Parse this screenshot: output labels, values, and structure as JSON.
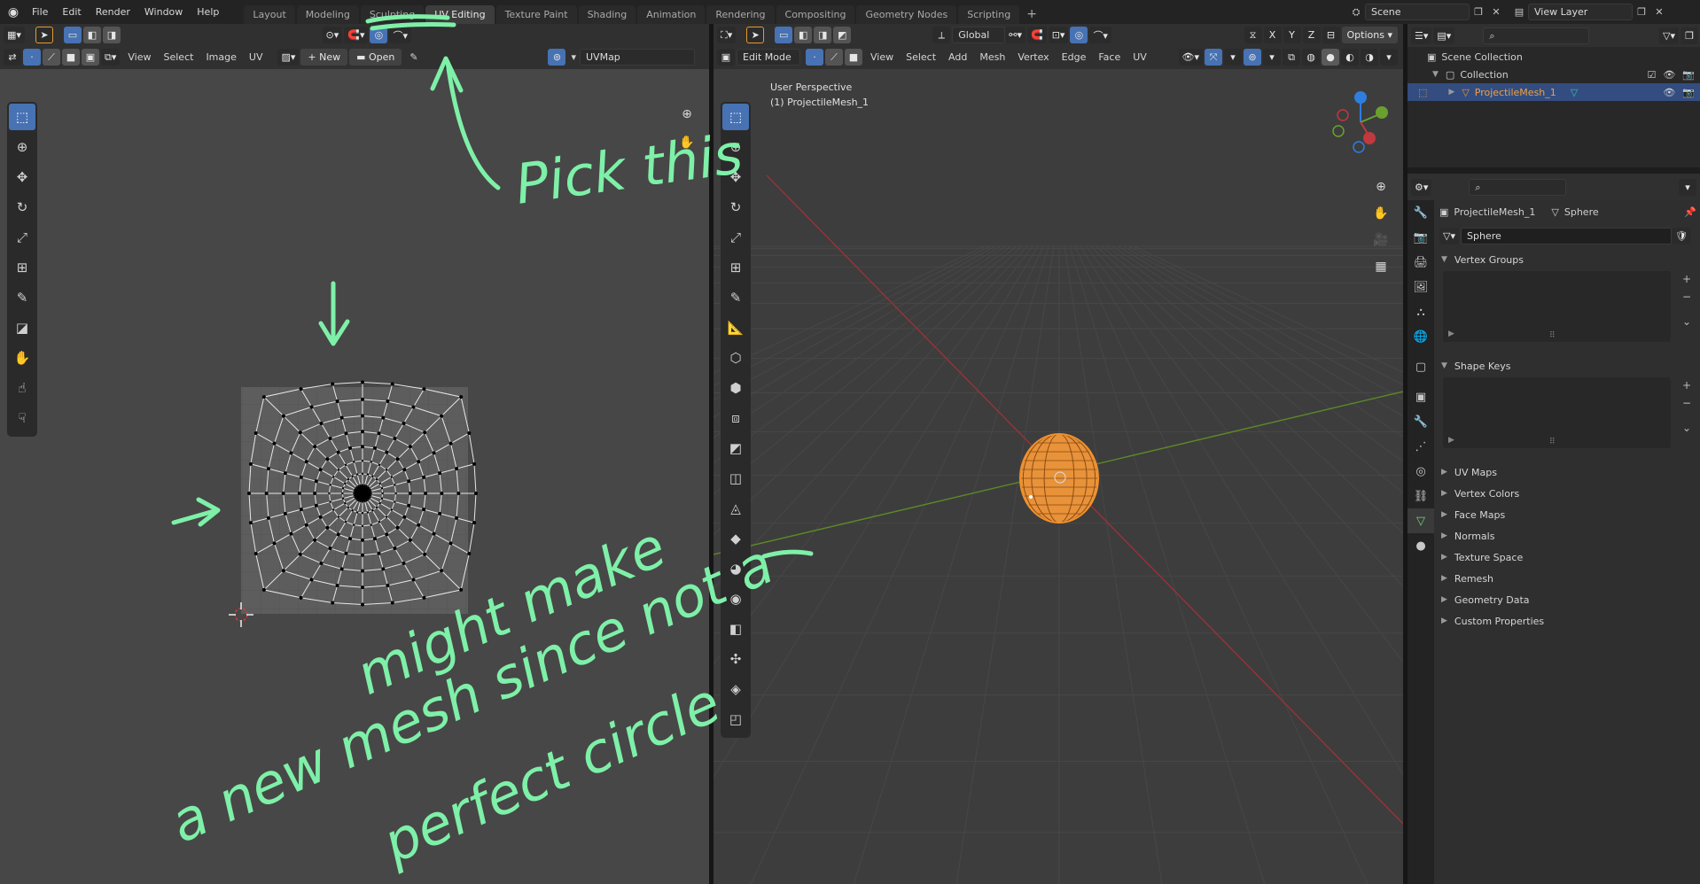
{
  "menubar": {
    "file": "File",
    "edit": "Edit",
    "render": "Render",
    "window": "Window",
    "help": "Help"
  },
  "workspaces": [
    "Layout",
    "Modeling",
    "Sculpting",
    "UV Editing",
    "Texture Paint",
    "Shading",
    "Animation",
    "Rendering",
    "Compositing",
    "Geometry Nodes",
    "Scripting"
  ],
  "active_workspace": "UV Editing",
  "scene": {
    "name": "Scene",
    "view_layer": "View Layer"
  },
  "uv_editor": {
    "menus": [
      "View",
      "Select",
      "Image",
      "UV"
    ],
    "new_label": "New",
    "open_label": "Open",
    "uvmap_name": "UVMap"
  },
  "viewport": {
    "mode": "Edit Mode",
    "menus": [
      "View",
      "Select",
      "Add",
      "Mesh",
      "Vertex",
      "Edge",
      "Face",
      "UV"
    ],
    "orientation": "Global",
    "options_label": "Options",
    "perspective_label": "User Perspective",
    "object_label": "(1) ProjectileMesh_1",
    "axis_x": "X",
    "axis_y": "Y",
    "axis_z": "Z"
  },
  "outliner": {
    "scene_collection": "Scene Collection",
    "collection": "Collection",
    "object": "ProjectileMesh_1"
  },
  "properties": {
    "object_name": "ProjectileMesh_1",
    "data_name": "Sphere",
    "mesh_field": "Sphere",
    "panels_open": [
      "Vertex Groups",
      "Shape Keys"
    ],
    "panels_closed": [
      "UV Maps",
      "Vertex Colors",
      "Face Maps",
      "Normals",
      "Texture Space",
      "Remesh",
      "Geometry Data",
      "Custom Properties"
    ]
  },
  "annotations": {
    "pick_this": "Pick this",
    "note_line1": "might make",
    "note_line2": "a new mesh since not a",
    "note_line3": "perfect circle",
    "color": "#7ef0a8"
  },
  "colors": {
    "accent_blue": "#4772b3",
    "selected_orange": "#f0912d",
    "x_axis": "#c0393f",
    "y_axis": "#6aa12e",
    "z_axis": "#2e7ee0"
  }
}
